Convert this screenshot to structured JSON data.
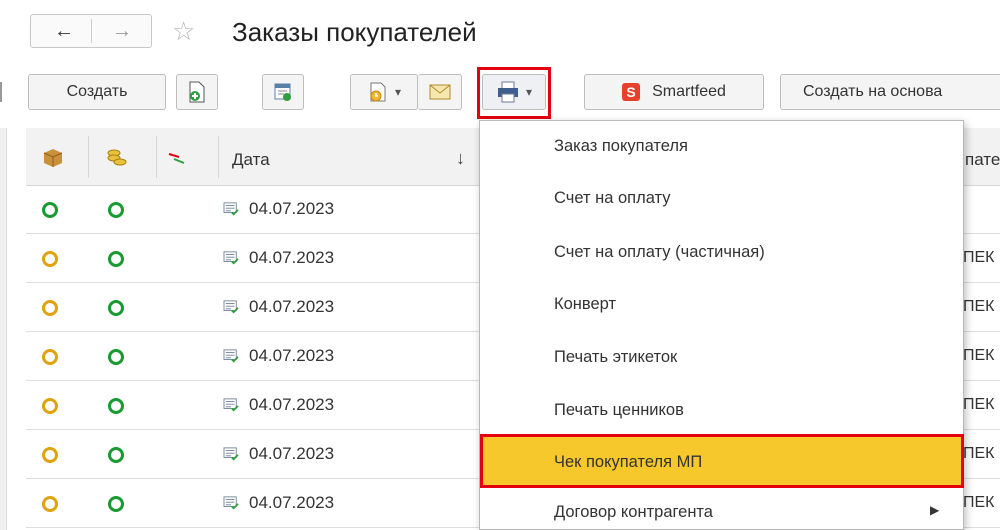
{
  "window": {
    "title": "Заказы покупателей",
    "back_icon": "←",
    "forward_icon": "→",
    "star_icon": "☆"
  },
  "toolbar": {
    "create_label": "Создать",
    "smartfeed_label": "Smartfeed",
    "smartfeed_icon_letter": "S",
    "create_based_label": "Создать на основа",
    "dropdown_glyph": "▾"
  },
  "table": {
    "header_date": "Дата",
    "sort_glyph": "↓",
    "header_right_partial": "пате",
    "rows": [
      {
        "date": "04.07.2023",
        "status1_color": "#1a9a32",
        "status2_color": "#1a9a32",
        "right": ""
      },
      {
        "date": "04.07.2023",
        "status1_color": "#e0a20e",
        "status2_color": "#1a9a32",
        "right": "ПЕК"
      },
      {
        "date": "04.07.2023",
        "status1_color": "#e0a20e",
        "status2_color": "#1a9a32",
        "right": "ПЕК"
      },
      {
        "date": "04.07.2023",
        "status1_color": "#e0a20e",
        "status2_color": "#1a9a32",
        "right": "ПЕК"
      },
      {
        "date": "04.07.2023",
        "status1_color": "#e0a20e",
        "status2_color": "#1a9a32",
        "right": "ПЕК"
      },
      {
        "date": "04.07.2023",
        "status1_color": "#e0a20e",
        "status2_color": "#1a9a32",
        "right": "ПЕК"
      },
      {
        "date": "04.07.2023",
        "status1_color": "#e0a20e",
        "status2_color": "#1a9a32",
        "right": "ПЕК"
      }
    ]
  },
  "print_menu": {
    "items": [
      "Заказ покупателя",
      "Счет на оплату",
      "Счет на оплату (частичная)",
      "Конверт",
      "Печать этикеток",
      "Печать ценников",
      "Чек покупателя МП",
      "Договор контрагента"
    ],
    "highlighted_index": 6,
    "submenu_glyph": "▶"
  },
  "colors": {
    "highlight_red": "#e3000f",
    "selected_item_bg": "#f7c82b",
    "status_green": "#1a9a32",
    "status_orange": "#e0a20e"
  }
}
